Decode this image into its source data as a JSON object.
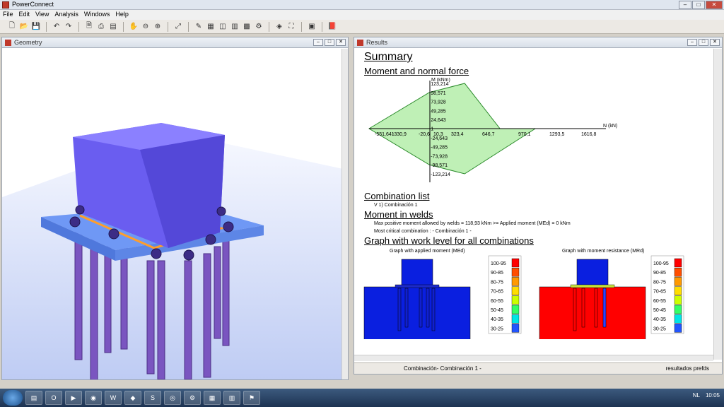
{
  "app": {
    "title": "PowerConnect"
  },
  "menu": [
    "File",
    "Edit",
    "View",
    "Analysis",
    "Windows",
    "Help"
  ],
  "geometry": {
    "title": "Geometry"
  },
  "results": {
    "title": "Results",
    "summary": "Summary",
    "moment_title": "Moment and normal force",
    "m_label": "M (kNm)",
    "n_label": "N (kN)",
    "m_ticks_pos": [
      "123,214",
      "98,571",
      "73,928",
      "49,285",
      "24,643",
      "1"
    ],
    "m_ticks_neg": [
      "-24,643",
      "-49,285",
      "-73,928",
      "-98,571",
      "-123,214"
    ],
    "n_ticks": [
      "-551,641",
      "-330,9",
      "-20,6",
      "10,3",
      "323,4",
      "646,7",
      "970,1",
      "1293,5",
      "1616,8"
    ],
    "combination_title": "Combination list",
    "combination_item": "V    1) Combinación 1",
    "welds_title": "Moment in welds",
    "welds_line1": "Max positive moment allowed by welds = 118,93 kNm >= Applied moment (MEd) = 0 kNm",
    "welds_line2": "Most critical combination : - Combinación 1 -",
    "graph_title": "Graph with work level for all combinations",
    "graph_left": "Graph with applied moment (MEd)",
    "graph_right": "Graph with moment resistance (MRd)",
    "legend": [
      "100-95",
      "90-85",
      "80-75",
      "70-65",
      "60-55",
      "50-45",
      "40-35",
      "30-25"
    ],
    "legend_colors": [
      "#ff0000",
      "#ff4d00",
      "#ff9900",
      "#ffdd00",
      "#ccff00",
      "#33ff66",
      "#00e5e5",
      "#2255ff"
    ],
    "status_left": "Combinación- Combinación 1 -",
    "status_right": "resultados prefds"
  },
  "chart_data": {
    "type": "area",
    "title": "Moment and normal force",
    "xlabel": "N (kN)",
    "ylabel": "M (kNm)",
    "x": [
      -551.6,
      0,
      323.4,
      646.7,
      970.1,
      323.4,
      0,
      -551.6
    ],
    "y": [
      0,
      98.571,
      123.214,
      0,
      0,
      -123.214,
      -98.571,
      0
    ],
    "xlim": [
      -551.641,
      1616.8
    ],
    "ylim": [
      -123.214,
      123.214
    ]
  },
  "taskbar": {
    "time": "10:05",
    "lang": "NL"
  }
}
